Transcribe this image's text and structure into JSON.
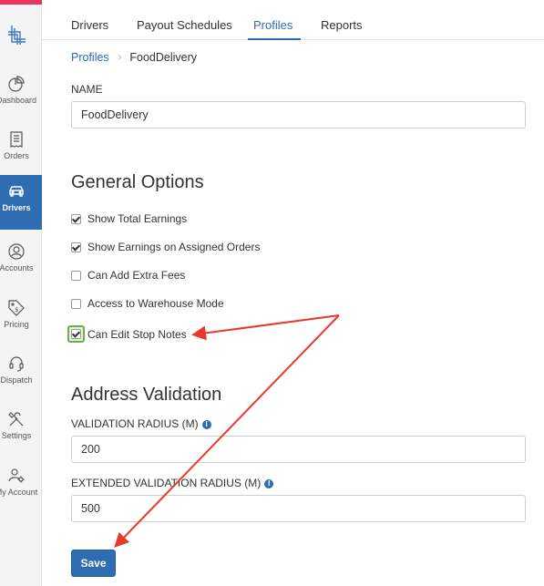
{
  "sidebar": {
    "items": [
      {
        "label": "Dashboard",
        "icon": "pie-chart-icon"
      },
      {
        "label": "Orders",
        "icon": "receipt-icon"
      },
      {
        "label": "Drivers",
        "icon": "car-icon",
        "active": true
      },
      {
        "label": "Accounts",
        "icon": "user-circle-icon"
      },
      {
        "label": "Pricing",
        "icon": "price-tag-icon"
      },
      {
        "label": "Dispatch",
        "icon": "headset-icon"
      },
      {
        "label": "Settings",
        "icon": "tools-icon"
      },
      {
        "label": "My Account",
        "icon": "user-gear-icon"
      }
    ]
  },
  "tabs": [
    {
      "label": "Drivers"
    },
    {
      "label": "Payout Schedules"
    },
    {
      "label": "Profiles",
      "active": true
    },
    {
      "label": "Reports"
    }
  ],
  "breadcrumb": {
    "parent": "Profiles",
    "separator": "›",
    "current": "FoodDelivery"
  },
  "name_field": {
    "label": "NAME",
    "value": "FoodDelivery"
  },
  "general_options": {
    "title": "General Options",
    "options": [
      {
        "label": "Show Total Earnings",
        "checked": true
      },
      {
        "label": "Show Earnings on Assigned Orders",
        "checked": true
      },
      {
        "label": "Can Add Extra Fees",
        "checked": false
      },
      {
        "label": "Access to Warehouse Mode",
        "checked": false
      },
      {
        "label": "Can Edit Stop Notes",
        "checked": true,
        "highlighted": true
      }
    ]
  },
  "address_validation": {
    "title": "Address Validation",
    "radius": {
      "label": "VALIDATION RADIUS (m)",
      "value": "200"
    },
    "extended_radius": {
      "label": "EXTENDED VALIDATION RADIUS (m)",
      "value": "500"
    }
  },
  "save_label": "Save",
  "colors": {
    "accent": "#2f6db3",
    "sidebar_top": "#e8365d",
    "annotation_arrow": "#e8392b",
    "highlight_border": "#6ab04c"
  }
}
